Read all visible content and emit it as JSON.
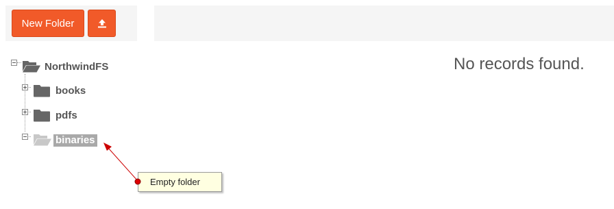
{
  "toolbar": {
    "new_folder_label": "New Folder",
    "upload_icon": "upload-icon"
  },
  "tree": {
    "root": {
      "label": "NorthwindFS",
      "expanded": true,
      "icon": "folder-open-icon",
      "children": [
        {
          "label": "books",
          "expanded": false,
          "icon": "folder-icon"
        },
        {
          "label": "pdfs",
          "expanded": false,
          "icon": "folder-icon"
        },
        {
          "label": "binaries",
          "expanded": true,
          "selected": true,
          "icon": "folder-open-icon"
        }
      ]
    }
  },
  "main": {
    "empty_message": "No records found."
  },
  "annotation": {
    "tooltip_text": "Empty folder"
  },
  "colors": {
    "accent": "#f15a29",
    "folder": "#666666",
    "folder_disabled": "#c8c8c8",
    "selection": "#a9a9a9",
    "tooltip_bg": "#ffffe1",
    "annotation_arrow": "#cc0000"
  }
}
